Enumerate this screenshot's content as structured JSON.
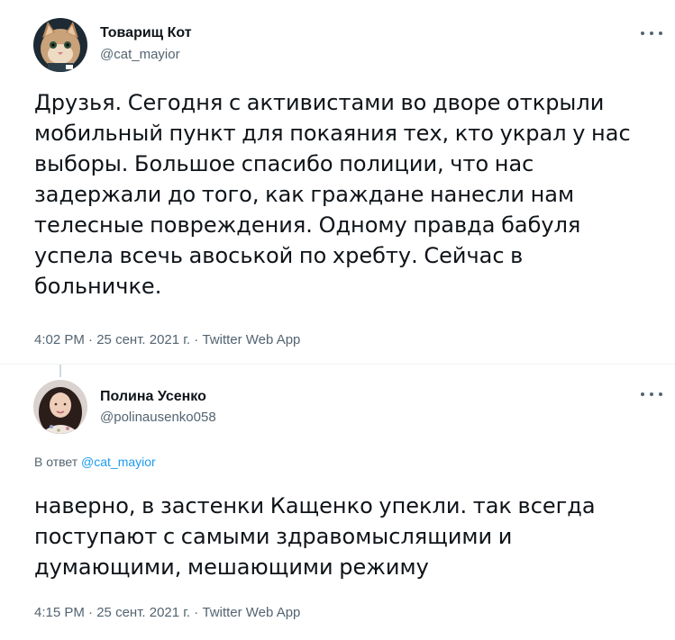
{
  "tweets": [
    {
      "author": {
        "name": "Товарищ Кот",
        "handle": "@cat_mayior"
      },
      "text_lines": [
        "Друзья. Сегодня с активистами во дворе открыли",
        "мобильный пункт для покаяния тех, кто украл у нас",
        "выборы. Большое спасибо полиции, что нас",
        "задержали до того, как граждане нанесли нам",
        "телесные повреждения. Одному правда бабуля",
        "успела всечь авоськой по хребту. Сейчас в",
        "больничке."
      ],
      "time": "4:02 PM",
      "date": "25 сент. 2021 г.",
      "source": "Twitter Web App",
      "separator": "·"
    },
    {
      "author": {
        "name": "Полина Усенко",
        "handle": "@polinausenko058"
      },
      "reply_prefix": "В ответ",
      "reply_mention": "@cat_mayior",
      "text_lines": [
        "наверно, в застенки Кащенко упекли. так всегда",
        "поступают с самыми здравомыслящими и",
        "думающими, мешающими режиму"
      ],
      "time": "4:15 PM",
      "date": "25 сент. 2021 г.",
      "source": "Twitter Web App",
      "separator": "·"
    }
  ],
  "colors": {
    "text": "#0f1419",
    "secondary": "#536471",
    "link": "#1d9bf0",
    "divider": "#eff3f4"
  },
  "icons": {
    "more": "more-dots-icon"
  }
}
